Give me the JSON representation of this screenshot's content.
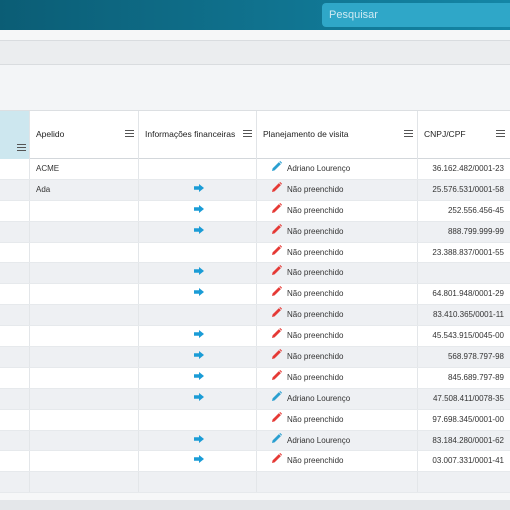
{
  "search": {
    "placeholder": "Pesquisar"
  },
  "columns": {
    "apelido": "Apelido",
    "financeiras": "Informações financeiras",
    "planejamento": "Planejamento de visita",
    "cnpj": "CNPJ/CPF"
  },
  "colors": {
    "arrow": "#1a9cd6",
    "pencil_blue": "#2a9fd0",
    "pencil_red": "#e53935"
  },
  "rows": [
    {
      "apelido": "ACME",
      "fin": false,
      "plan": "Adriano Lourenço",
      "planned": true,
      "cnpj": "36.162.482/0001-23"
    },
    {
      "apelido": "Ada",
      "fin": true,
      "plan": "Não preenchido",
      "planned": false,
      "cnpj": "25.576.531/0001-58"
    },
    {
      "apelido": "",
      "fin": true,
      "plan": "Não preenchido",
      "planned": false,
      "cnpj": "252.556.456-45"
    },
    {
      "apelido": "",
      "fin": true,
      "plan": "Não preenchido",
      "planned": false,
      "cnpj": "888.799.999-99"
    },
    {
      "apelido": "",
      "fin": false,
      "plan": "Não preenchido",
      "planned": false,
      "cnpj": "23.388.837/0001-55"
    },
    {
      "apelido": "",
      "fin": true,
      "plan": "Não preenchido",
      "planned": false,
      "cnpj": ""
    },
    {
      "apelido": "",
      "fin": true,
      "plan": "Não preenchido",
      "planned": false,
      "cnpj": "64.801.948/0001-29"
    },
    {
      "apelido": "",
      "fin": false,
      "plan": "Não preenchido",
      "planned": false,
      "cnpj": "83.410.365/0001-11"
    },
    {
      "apelido": "",
      "fin": true,
      "plan": "Não preenchido",
      "planned": false,
      "cnpj": "45.543.915/0045-00"
    },
    {
      "apelido": "",
      "fin": true,
      "plan": "Não preenchido",
      "planned": false,
      "cnpj": "568.978.797-98"
    },
    {
      "apelido": "",
      "fin": true,
      "plan": "Não preenchido",
      "planned": false,
      "cnpj": "845.689.797-89"
    },
    {
      "apelido": "",
      "fin": true,
      "plan": "Adriano Lourenço",
      "planned": true,
      "cnpj": "47.508.411/0078-35"
    },
    {
      "apelido": "",
      "fin": false,
      "plan": "Não preenchido",
      "planned": false,
      "cnpj": "97.698.345/0001-00"
    },
    {
      "apelido": "",
      "fin": true,
      "plan": "Adriano Lourenço",
      "planned": true,
      "cnpj": "83.184.280/0001-62"
    },
    {
      "apelido": "",
      "fin": true,
      "plan": "Não preenchido",
      "planned": false,
      "cnpj": "03.007.331/0001-41"
    },
    {
      "apelido": "",
      "fin": false,
      "plan": "",
      "planned": null,
      "cnpj": ""
    }
  ]
}
